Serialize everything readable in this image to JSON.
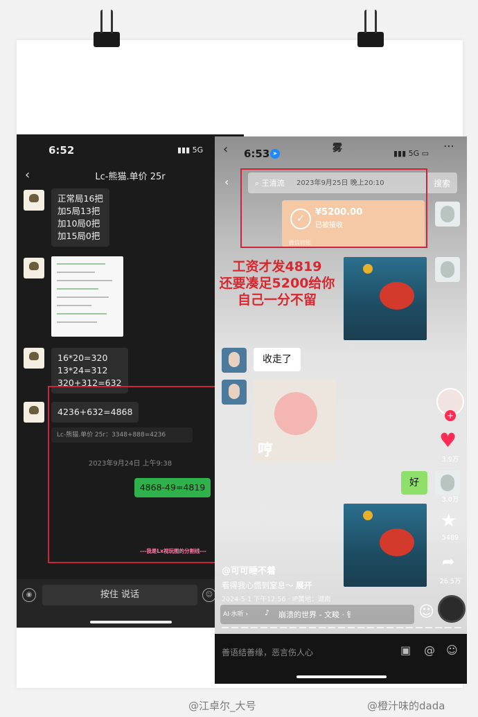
{
  "left_chat": {
    "status_time": "6:52",
    "signal": "5G",
    "title": "Lc-熊猫.单价 25r",
    "msg1_lines": [
      "正常局16把",
      "加5局13把",
      "加10局0把",
      "加15局0把"
    ],
    "calc_lines": [
      "16*20=320",
      "13*24=312",
      "320+312=632"
    ],
    "total": "4236+632=4868",
    "quote": "Lc-熊猫.单价 25r：3348+888=4236",
    "timestamp": "2023年9月24日 上午9:38",
    "sent": "4868-49=4819",
    "divider": "---我是Lx视玩图的分割线---",
    "voice_button": "按住 说话"
  },
  "right_feed": {
    "status_time": "6:53",
    "signal": "5G",
    "top_title": "雾",
    "search_query": "王清流",
    "search_date": "2023年9月25日 晚上20:10",
    "search_button": "搜索",
    "payment_amount": "¥5200.00",
    "payment_status": "已被接收",
    "payment_footer": "微信转账",
    "caption_lines": [
      "工资才发4819",
      "还要凑足5200给你",
      "自己一分不留"
    ],
    "msg_taken": "收走了",
    "sticker_text": "哼",
    "reply": "好",
    "likes": "3.9万",
    "comments": "3.0万",
    "favorites": "5489",
    "shares": "26.5万",
    "author": "@可可睡不着",
    "description": "看得我心慌到窒息～",
    "expand": "展开",
    "post_meta": "2024-5-1 下午12:56 · IP属地：湖南",
    "ai_listen": "AI·水听 ›",
    "song": "崩溃的世界 - 文畯 · 钅",
    "comment_placeholder": "善语结善缘，恶言伤人心"
  },
  "watermarks": [
    "@江卓尔_大号",
    "@橙汁味的dada"
  ],
  "colors": {
    "highlight": "#d0233a",
    "wechat_green": "#2fb14b",
    "caption_red": "#d8282f",
    "like_red": "#fe2c55"
  }
}
